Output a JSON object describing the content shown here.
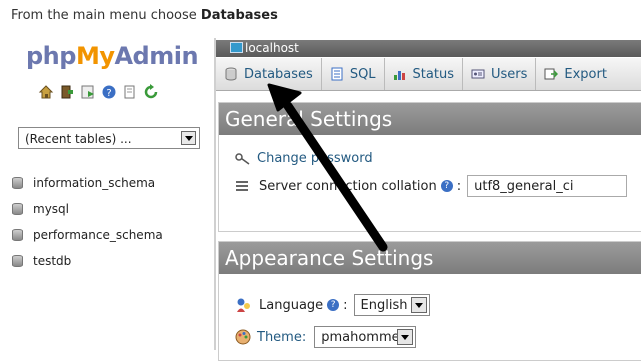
{
  "instruction": {
    "prefix": "From the main menu choose",
    "bold": "Databases"
  },
  "logo": {
    "php": "php",
    "my": "My",
    "admin": "Admin"
  },
  "left_icons": [
    "home-icon",
    "exit-icon",
    "query-window-icon",
    "help-icon",
    "docs-icon",
    "reload-icon"
  ],
  "recent_tables": {
    "selected": "(Recent tables) ..."
  },
  "databases": [
    "information_schema",
    "mysql",
    "performance_schema",
    "testdb"
  ],
  "server": {
    "label": "localhost"
  },
  "tabs": [
    {
      "label": "Databases",
      "icon": "database-icon"
    },
    {
      "label": "SQL",
      "icon": "sql-icon"
    },
    {
      "label": "Status",
      "icon": "status-icon"
    },
    {
      "label": "Users",
      "icon": "users-icon"
    },
    {
      "label": "Export",
      "icon": "export-icon"
    }
  ],
  "general_settings": {
    "title": "General Settings",
    "change_password": "Change password",
    "collation_label": "Server connection collation",
    "collation_value": "utf8_general_ci"
  },
  "appearance_settings": {
    "title": "Appearance Settings",
    "language_label": "Language",
    "language_value": "English",
    "theme_label": "Theme:",
    "theme_value": "pmahomme"
  },
  "colors": {
    "link": "#235a81",
    "panel_header": "#8a8a8a",
    "logo_php": "#6c78af",
    "logo_my": "#f29400",
    "arrow": "#000000"
  }
}
